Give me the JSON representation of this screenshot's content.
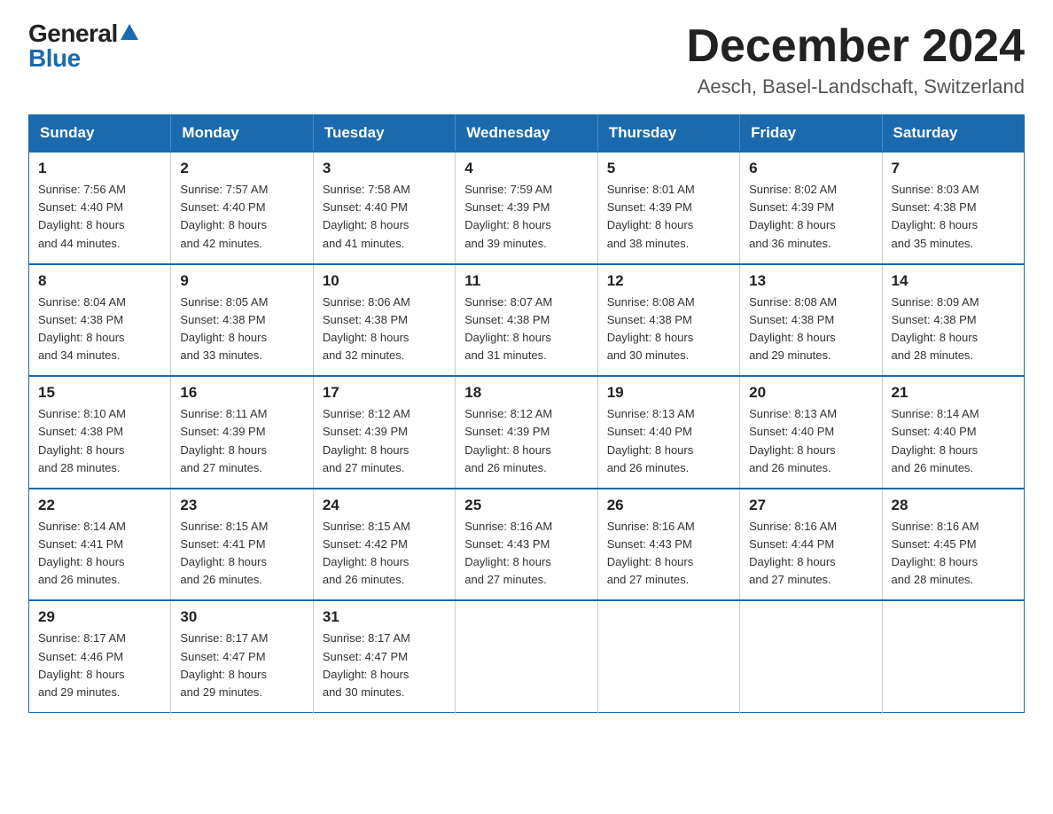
{
  "logo": {
    "general": "General",
    "blue": "Blue"
  },
  "title": "December 2024",
  "location": "Aesch, Basel-Landschaft, Switzerland",
  "days_of_week": [
    "Sunday",
    "Monday",
    "Tuesday",
    "Wednesday",
    "Thursday",
    "Friday",
    "Saturday"
  ],
  "weeks": [
    [
      {
        "day": "1",
        "sunrise": "7:56 AM",
        "sunset": "4:40 PM",
        "daylight": "8 hours and 44 minutes."
      },
      {
        "day": "2",
        "sunrise": "7:57 AM",
        "sunset": "4:40 PM",
        "daylight": "8 hours and 42 minutes."
      },
      {
        "day": "3",
        "sunrise": "7:58 AM",
        "sunset": "4:40 PM",
        "daylight": "8 hours and 41 minutes."
      },
      {
        "day": "4",
        "sunrise": "7:59 AM",
        "sunset": "4:39 PM",
        "daylight": "8 hours and 39 minutes."
      },
      {
        "day": "5",
        "sunrise": "8:01 AM",
        "sunset": "4:39 PM",
        "daylight": "8 hours and 38 minutes."
      },
      {
        "day": "6",
        "sunrise": "8:02 AM",
        "sunset": "4:39 PM",
        "daylight": "8 hours and 36 minutes."
      },
      {
        "day": "7",
        "sunrise": "8:03 AM",
        "sunset": "4:38 PM",
        "daylight": "8 hours and 35 minutes."
      }
    ],
    [
      {
        "day": "8",
        "sunrise": "8:04 AM",
        "sunset": "4:38 PM",
        "daylight": "8 hours and 34 minutes."
      },
      {
        "day": "9",
        "sunrise": "8:05 AM",
        "sunset": "4:38 PM",
        "daylight": "8 hours and 33 minutes."
      },
      {
        "day": "10",
        "sunrise": "8:06 AM",
        "sunset": "4:38 PM",
        "daylight": "8 hours and 32 minutes."
      },
      {
        "day": "11",
        "sunrise": "8:07 AM",
        "sunset": "4:38 PM",
        "daylight": "8 hours and 31 minutes."
      },
      {
        "day": "12",
        "sunrise": "8:08 AM",
        "sunset": "4:38 PM",
        "daylight": "8 hours and 30 minutes."
      },
      {
        "day": "13",
        "sunrise": "8:08 AM",
        "sunset": "4:38 PM",
        "daylight": "8 hours and 29 minutes."
      },
      {
        "day": "14",
        "sunrise": "8:09 AM",
        "sunset": "4:38 PM",
        "daylight": "8 hours and 28 minutes."
      }
    ],
    [
      {
        "day": "15",
        "sunrise": "8:10 AM",
        "sunset": "4:38 PM",
        "daylight": "8 hours and 28 minutes."
      },
      {
        "day": "16",
        "sunrise": "8:11 AM",
        "sunset": "4:39 PM",
        "daylight": "8 hours and 27 minutes."
      },
      {
        "day": "17",
        "sunrise": "8:12 AM",
        "sunset": "4:39 PM",
        "daylight": "8 hours and 27 minutes."
      },
      {
        "day": "18",
        "sunrise": "8:12 AM",
        "sunset": "4:39 PM",
        "daylight": "8 hours and 26 minutes."
      },
      {
        "day": "19",
        "sunrise": "8:13 AM",
        "sunset": "4:40 PM",
        "daylight": "8 hours and 26 minutes."
      },
      {
        "day": "20",
        "sunrise": "8:13 AM",
        "sunset": "4:40 PM",
        "daylight": "8 hours and 26 minutes."
      },
      {
        "day": "21",
        "sunrise": "8:14 AM",
        "sunset": "4:40 PM",
        "daylight": "8 hours and 26 minutes."
      }
    ],
    [
      {
        "day": "22",
        "sunrise": "8:14 AM",
        "sunset": "4:41 PM",
        "daylight": "8 hours and 26 minutes."
      },
      {
        "day": "23",
        "sunrise": "8:15 AM",
        "sunset": "4:41 PM",
        "daylight": "8 hours and 26 minutes."
      },
      {
        "day": "24",
        "sunrise": "8:15 AM",
        "sunset": "4:42 PM",
        "daylight": "8 hours and 26 minutes."
      },
      {
        "day": "25",
        "sunrise": "8:16 AM",
        "sunset": "4:43 PM",
        "daylight": "8 hours and 27 minutes."
      },
      {
        "day": "26",
        "sunrise": "8:16 AM",
        "sunset": "4:43 PM",
        "daylight": "8 hours and 27 minutes."
      },
      {
        "day": "27",
        "sunrise": "8:16 AM",
        "sunset": "4:44 PM",
        "daylight": "8 hours and 27 minutes."
      },
      {
        "day": "28",
        "sunrise": "8:16 AM",
        "sunset": "4:45 PM",
        "daylight": "8 hours and 28 minutes."
      }
    ],
    [
      {
        "day": "29",
        "sunrise": "8:17 AM",
        "sunset": "4:46 PM",
        "daylight": "8 hours and 29 minutes."
      },
      {
        "day": "30",
        "sunrise": "8:17 AM",
        "sunset": "4:47 PM",
        "daylight": "8 hours and 29 minutes."
      },
      {
        "day": "31",
        "sunrise": "8:17 AM",
        "sunset": "4:47 PM",
        "daylight": "8 hours and 30 minutes."
      },
      null,
      null,
      null,
      null
    ]
  ],
  "labels": {
    "sunrise": "Sunrise:",
    "sunset": "Sunset:",
    "daylight": "Daylight:"
  }
}
